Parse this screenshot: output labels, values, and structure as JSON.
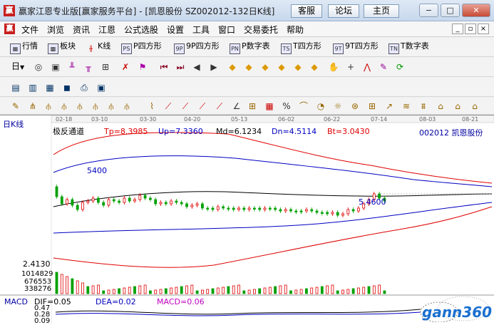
{
  "window": {
    "logo_char": "赢",
    "title": "赢家江恩专业版[赢家服务平台] - [凯恩股份  SZ002012-132日K线]",
    "buttons": [
      "客服",
      "论坛",
      "主页"
    ],
    "controls": {
      "minimize": "−",
      "maximize": "□",
      "close": "✕"
    }
  },
  "menu": {
    "logo_char": "赢",
    "items": [
      "文件",
      "浏览",
      "资讯",
      "江恩",
      "公式选股",
      "设置",
      "工具",
      "窗口",
      "交易委托",
      "帮助"
    ],
    "mdi_controls": [
      "_",
      "▫",
      "×"
    ]
  },
  "toolbar1": {
    "items": [
      {
        "label": "行情",
        "icon": "grid-icon"
      },
      {
        "label": "板块",
        "icon": "blocks-icon"
      },
      {
        "label": "K线",
        "icon": "candle-icon"
      },
      {
        "label": "P四方形",
        "icon": "p-square-icon",
        "icon_text": "PS"
      },
      {
        "label": "9P四方形",
        "icon": "9p-square-icon",
        "icon_text": "9P"
      },
      {
        "label": "P数字表",
        "icon": "p-table-icon",
        "icon_text": "PN"
      },
      {
        "label": "T四方形",
        "icon": "t-square-icon",
        "icon_text": "TS"
      },
      {
        "label": "9T四方形",
        "icon": "9t-square-icon",
        "icon_text": "9T"
      },
      {
        "label": "T数字表",
        "icon": "t-table-icon",
        "icon_text": "TN"
      }
    ]
  },
  "toolbar2": {
    "period": "日"
  },
  "chart": {
    "panel_title": "日K线",
    "indicator_name": "极反通道",
    "params": [
      {
        "text": "Tp=8.3985",
        "color": "#e00000"
      },
      {
        "text": "Up=7.3360",
        "color": "#0000c0"
      },
      {
        "text": "Md=6.1234",
        "color": "#000000"
      },
      {
        "text": "Dn=4.5114",
        "color": "#0000c0"
      },
      {
        "text": "Bt=3.0430",
        "color": "#e00000"
      }
    ],
    "stock": "002012  凯恩股份",
    "dates": [
      "02-18",
      "03-10",
      "03-30",
      "04-20",
      "05-13",
      "06-02",
      "06-22",
      "07-14",
      "08-03",
      "08-21"
    ],
    "price_label_high": "5400",
    "price_label_low": "5.4600",
    "price_low_axis": "2.4130",
    "volume_ticks": [
      "1014829",
      "676553",
      "338276"
    ],
    "macd_ticks": [
      "0.47",
      "0.28",
      "0.09"
    ],
    "macd_label": "MACD",
    "macd_params": [
      {
        "text": "DIF=0.05",
        "color": "#000000"
      },
      {
        "text": "DEA=0.02",
        "color": "#0000c0"
      },
      {
        "text": "MACD=0.06",
        "color": "#c000c0"
      }
    ],
    "colors": {
      "up": "#e00000",
      "down": "#00a000",
      "channel_outer": "#e00000",
      "channel_inner": "#0000c0",
      "mid": "#000000"
    }
  },
  "watermark": {
    "text": "gann360"
  }
}
